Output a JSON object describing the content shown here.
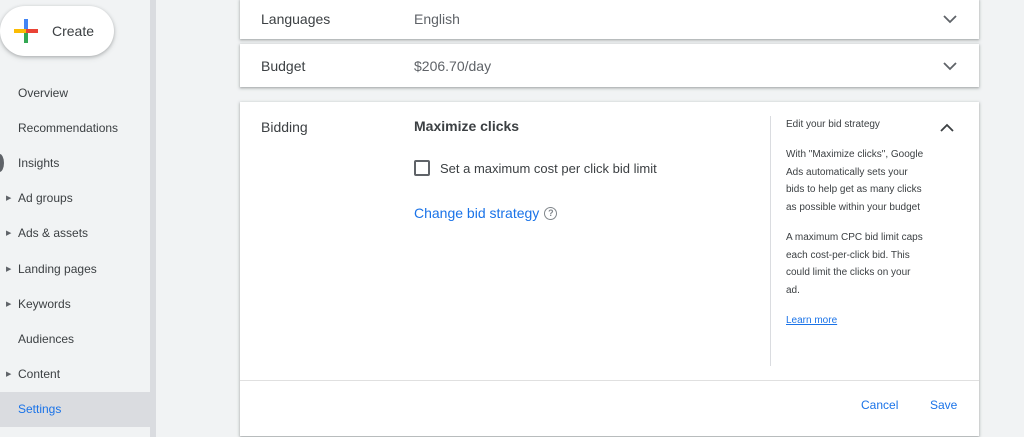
{
  "sidebar": {
    "create_label": "Create",
    "items": [
      {
        "label": "Overview",
        "expandable": false
      },
      {
        "label": "Recommendations",
        "expandable": false
      },
      {
        "label": "Insights",
        "expandable": false
      },
      {
        "label": "Ad groups",
        "expandable": true
      },
      {
        "label": "Ads & assets",
        "expandable": true
      },
      {
        "label": "Landing pages",
        "expandable": true
      },
      {
        "label": "Keywords",
        "expandable": true
      },
      {
        "label": "Audiences",
        "expandable": false
      },
      {
        "label": "Content",
        "expandable": true
      },
      {
        "label": "Settings",
        "expandable": false,
        "active": true
      }
    ]
  },
  "languages": {
    "label": "Languages",
    "value": "English"
  },
  "budget": {
    "label": "Budget",
    "value": "$206.70/day"
  },
  "bidding": {
    "label": "Bidding",
    "strategy_title": "Maximize clicks",
    "checkbox_label": "Set a maximum cost per click bid limit",
    "checkbox_checked": false,
    "change_link": "Change bid strategy",
    "help": {
      "title": "Edit your bid strategy",
      "para1": "With \"Maximize clicks\", Google Ads automatically sets your bids to help get as many clicks as possible within your budget",
      "para2": "A maximum CPC bid limit caps each cost-per-click bid. This could limit the clicks on your ad.",
      "learn_more": "Learn more"
    },
    "cancel_label": "Cancel",
    "save_label": "Save"
  },
  "colors": {
    "accent": "#1a73e8",
    "active_bg": "#dadce0",
    "page_bg": "#f1f3f4"
  },
  "icons": {
    "create": "plus-icon",
    "expand": "chevron-down-icon",
    "collapse": "chevron-up-icon",
    "help": "help-circle-icon",
    "caret": "caret-right-icon"
  }
}
